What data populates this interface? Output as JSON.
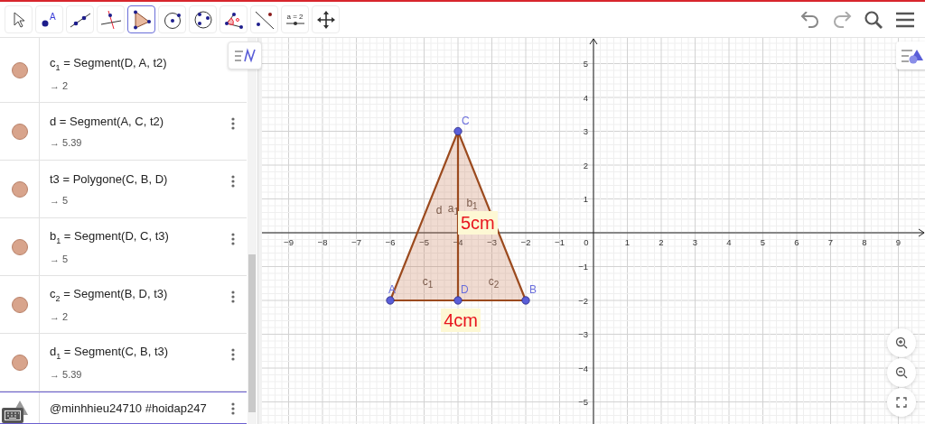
{
  "toolbar": {
    "tools": [
      {
        "kind": "move",
        "selected": false
      },
      {
        "kind": "point",
        "selected": false,
        "label": "A"
      },
      {
        "kind": "line",
        "selected": false
      },
      {
        "kind": "perpendicular",
        "selected": false
      },
      {
        "kind": "polygon",
        "selected": true
      },
      {
        "kind": "circle",
        "selected": false
      },
      {
        "kind": "circle3",
        "selected": false
      },
      {
        "kind": "angle",
        "selected": false
      },
      {
        "kind": "reflect",
        "selected": false
      },
      {
        "kind": "slider",
        "selected": false,
        "label": "a = 2"
      },
      {
        "kind": "pan",
        "selected": false
      }
    ],
    "actions": [
      {
        "kind": "undo"
      },
      {
        "kind": "redo"
      },
      {
        "kind": "search"
      },
      {
        "kind": "menu"
      }
    ]
  },
  "algebra": {
    "rows": [
      {
        "formula": "c$_{1}$ = Segment(D, A, t2)",
        "value": "→ 2",
        "menu": false
      },
      {
        "formula": "d = Segment(A, C, t2)",
        "value": "→ 5.39",
        "menu": true
      },
      {
        "formula": "t3 = Polygone(C, B, D)",
        "value": "→ 5",
        "menu": true
      },
      {
        "formula": "b$_{1}$ = Segment(D, C, t3)",
        "value": "→ 5",
        "menu": true
      },
      {
        "formula": "c$_{2}$ = Segment(B, D, t3)",
        "value": "→ 2",
        "menu": true
      },
      {
        "formula": "d$_{1}$ = Segment(C, B, t3)",
        "value": "→ 5.39",
        "menu": true
      }
    ],
    "input": {
      "value": "@minhhieu24710 #hoidap247"
    }
  },
  "graphics": {
    "x_labels": [
      "−9",
      "−8",
      "−7",
      "−6",
      "−5",
      "−4",
      "−3",
      "−2",
      "−1",
      "0",
      "1",
      "2",
      "3",
      "4",
      "5",
      "6",
      "7",
      "8",
      "9"
    ],
    "y_labels": [
      "5",
      "4",
      "3",
      "2",
      "1",
      "−1",
      "−2",
      "−3",
      "−4",
      "−5"
    ],
    "points": [
      {
        "label": "C",
        "kind": "apex"
      },
      {
        "label": "A",
        "kind": "vertex"
      },
      {
        "label": "D",
        "kind": "foot"
      },
      {
        "label": "B",
        "kind": "vertex"
      }
    ],
    "segment_labels": [
      "d",
      "a$_{1}$",
      "b$_{1}$",
      "c$_{1}$",
      "c$_{2}$"
    ],
    "texts": [
      "5cm",
      "4cm"
    ]
  }
}
